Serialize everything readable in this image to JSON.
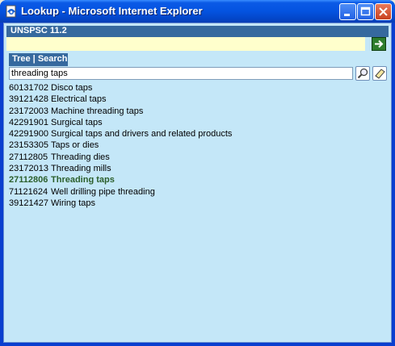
{
  "window": {
    "title": "Lookup - Microsoft Internet Explorer",
    "icon": "ie-page-icon"
  },
  "header": {
    "title": "UNSPSC 11.2"
  },
  "tabs": {
    "label": "Tree | Search"
  },
  "search": {
    "value": "threading taps"
  },
  "results": [
    {
      "code": "60131702",
      "label": "Disco taps",
      "selected": false
    },
    {
      "code": "39121428",
      "label": "Electrical taps",
      "selected": false
    },
    {
      "code": "23172003",
      "label": "Machine threading taps",
      "selected": false
    },
    {
      "code": "42291901",
      "label": "Surgical taps",
      "selected": false
    },
    {
      "code": "42291900",
      "label": "Surgical taps and drivers and related products",
      "selected": false
    },
    {
      "code": "23153305",
      "label": "Taps or dies",
      "selected": false
    },
    {
      "code": "27112805",
      "label": "Threading dies",
      "selected": false
    },
    {
      "code": "23172013",
      "label": "Threading mills",
      "selected": false
    },
    {
      "code": "27112806",
      "label": "Threading taps",
      "selected": true
    },
    {
      "code": "71121624",
      "label": "Well drilling pipe threading",
      "selected": false
    },
    {
      "code": "39121427",
      "label": "Wiring taps",
      "selected": false
    }
  ],
  "colors": {
    "background": "#c4e7f8",
    "header": "#36699e",
    "selected_text": "#2c5f2c"
  }
}
